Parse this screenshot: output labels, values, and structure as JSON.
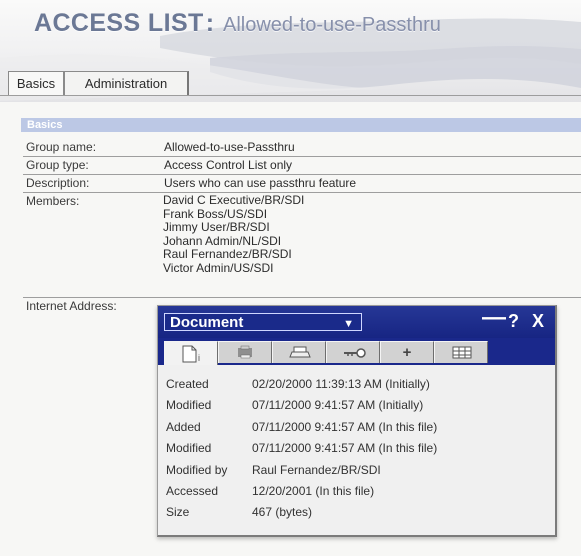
{
  "header": {
    "title_prefix": "ACCESS LIST",
    "title_name": "Allowed-to-use-Passthru",
    "colors": {
      "title": "#6b7895",
      "title_name": "#8790ab",
      "background": "#f7f7f5",
      "accent_bar": "#bcc8e5",
      "popup_titlebar": "#172583"
    }
  },
  "tabs": {
    "basics": "Basics",
    "administration": "Administration"
  },
  "basics": {
    "section_title": "Basics",
    "group_name_label": "Group name:",
    "group_name_value": "Allowed-to-use-Passthru",
    "group_type_label": "Group type:",
    "group_type_value": "Access Control List only",
    "description_label": "Description:",
    "description_value": "Users who can use passthru feature",
    "members_label": "Members:",
    "members": [
      "David C Executive/BR/SDI",
      "Frank Boss/US/SDI",
      "Jimmy User/BR/SDI",
      "Johann Admin/NL/SDI",
      "Raul Fernandez/BR/SDI",
      "Victor Admin/US/SDI"
    ],
    "internet_address_label": "Internet Address:"
  },
  "document_properties": {
    "selected": "Document",
    "tabs": [
      {
        "name": "general",
        "icon": "document-icon",
        "suffix": "i"
      },
      {
        "name": "printer",
        "icon": "printer-icon"
      },
      {
        "name": "print",
        "icon": "print-icon"
      },
      {
        "name": "key",
        "icon": "key-icon"
      },
      {
        "name": "plus",
        "icon": "plus-icon",
        "label": "+"
      },
      {
        "name": "advanced",
        "icon": "grid-icon"
      }
    ],
    "properties": [
      {
        "label": "Created",
        "value": "02/20/2000 11:39:13 AM (Initially)"
      },
      {
        "label": "Modified",
        "value": "07/11/2000 9:41:57 AM (Initially)"
      },
      {
        "label": "Added",
        "value": "07/11/2000 9:41:57 AM (In this file)"
      },
      {
        "label": "Modified",
        "value": "07/11/2000 9:41:57 AM (In this file)"
      },
      {
        "label": "Modified by",
        "value": "Raul Fernandez/BR/SDI"
      },
      {
        "label": "Accessed",
        "value": "12/20/2001 (In this file)"
      },
      {
        "label": "Size",
        "value": "467 (bytes)"
      }
    ],
    "titlebar_icons": [
      "minimize-icon",
      "help-icon",
      "close-icon"
    ],
    "tab_plus_label": "+",
    "general_tab_suffix": "i",
    "help_label": "?",
    "close_label": "X"
  }
}
